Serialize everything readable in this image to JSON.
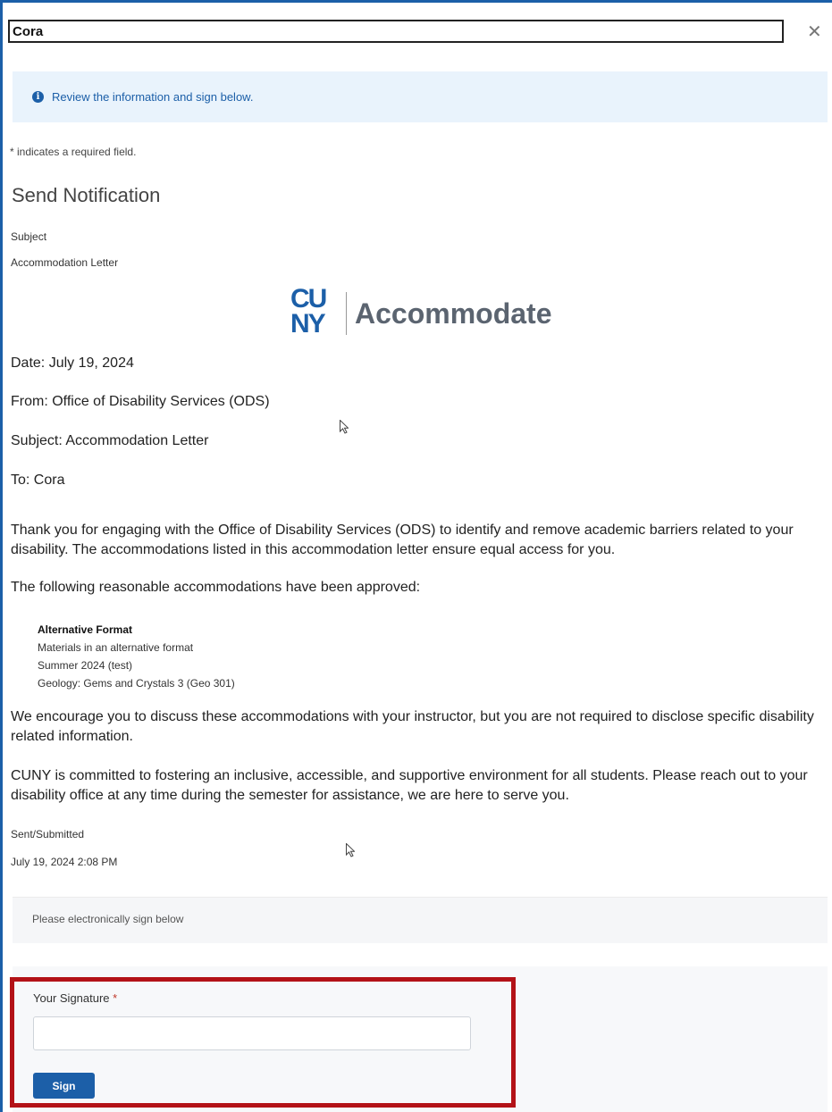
{
  "header": {
    "title": "Cora",
    "close_icon": "close-icon"
  },
  "info_banner": {
    "icon": "info-icon",
    "text": "Review the information and sign below."
  },
  "required_note": "* indicates a required field.",
  "section_title": "Send Notification",
  "subject": {
    "label": "Subject",
    "value": "Accommodation Letter"
  },
  "logo": {
    "mark_line1": "CU",
    "mark_line2": "NY",
    "word": "Accommodate"
  },
  "letter": {
    "date": "Date: July 19, 2024",
    "from": "From: Office of Disability Services (ODS)",
    "subject": "Subject: Accommodation Letter",
    "to": "To: Cora",
    "intro": "Thank you for engaging with the Office of Disability Services (ODS) to identify and remove academic barriers related to your disability.  The accommodations listed in this accommodation letter ensure equal access for you.",
    "approved_intro": "The following reasonable accommodations have been approved:",
    "accommodation": {
      "title": "Alternative Format",
      "description": "Materials in an alternative format",
      "term": "Summer 2024 (test)",
      "course": "Geology: Gems and Crystals 3 (Geo 301)"
    },
    "encourage": "We encourage you to discuss these accommodations with your instructor, but you are not required to disclose specific disability related information.",
    "commitment": "CUNY is committed to fostering an inclusive, accessible, and supportive environment for all students. Please reach out to your disability office at any time during the semester for assistance, we are here to serve you."
  },
  "sent": {
    "label": "Sent/Submitted",
    "value": "July 19, 2024 2:08 PM"
  },
  "sign_banner": "Please electronically sign below",
  "signature": {
    "label": "Your Signature",
    "required_mark": "*",
    "value": "",
    "button_label": "Sign"
  },
  "colors": {
    "accent": "#1c5fa8",
    "highlight_border": "#b31217",
    "info_bg": "#e9f3fc"
  }
}
